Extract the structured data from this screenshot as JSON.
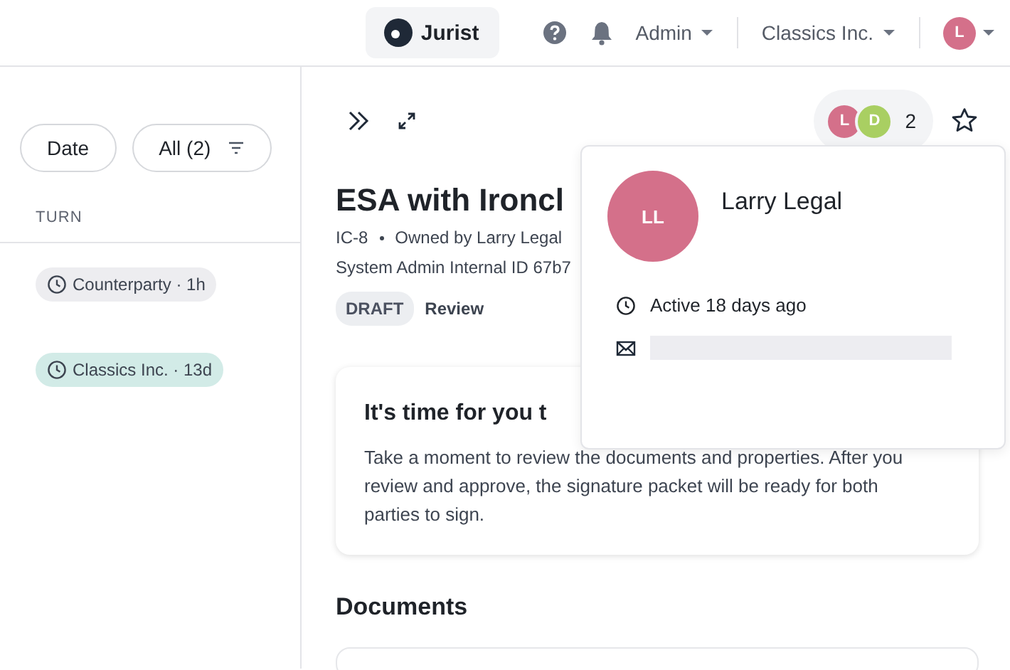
{
  "topbar": {
    "workspace": "Jurist",
    "menus": [
      {
        "label": "Admin"
      },
      {
        "label": "Classics Inc."
      }
    ],
    "user_initial": "L"
  },
  "list_panel": {
    "filters": [
      {
        "label": "Date",
        "kind": "plain"
      },
      {
        "label": "All (2)",
        "kind": "filter"
      }
    ],
    "column_header": "TURN",
    "rows": [
      {
        "turn": "Counterparty · 1h",
        "color": "#ededf0"
      },
      {
        "turn": "Classics Inc. · 13d",
        "color": "#d2ebe7"
      }
    ]
  },
  "detail": {
    "viewers": [
      {
        "initial": "L",
        "color": "#d4708a"
      },
      {
        "initial": "D",
        "color": "#a9cf62"
      }
    ],
    "viewer_count": "2",
    "title": "ESA with Ironcl",
    "id": "IC-8",
    "owner": "Owned by Larry Legal",
    "internal_id": "System Admin Internal ID 67b7",
    "status": "DRAFT",
    "stage": "Review",
    "notice": {
      "title": "It's time for you t",
      "body": "Take a moment to review the documents and properties. After you review and approve, the signature packet will be ready for both parties to sign."
    },
    "section": "Documents"
  },
  "popover": {
    "initials": "LL",
    "name": "Larry Legal",
    "activity": "Active 18 days ago"
  }
}
